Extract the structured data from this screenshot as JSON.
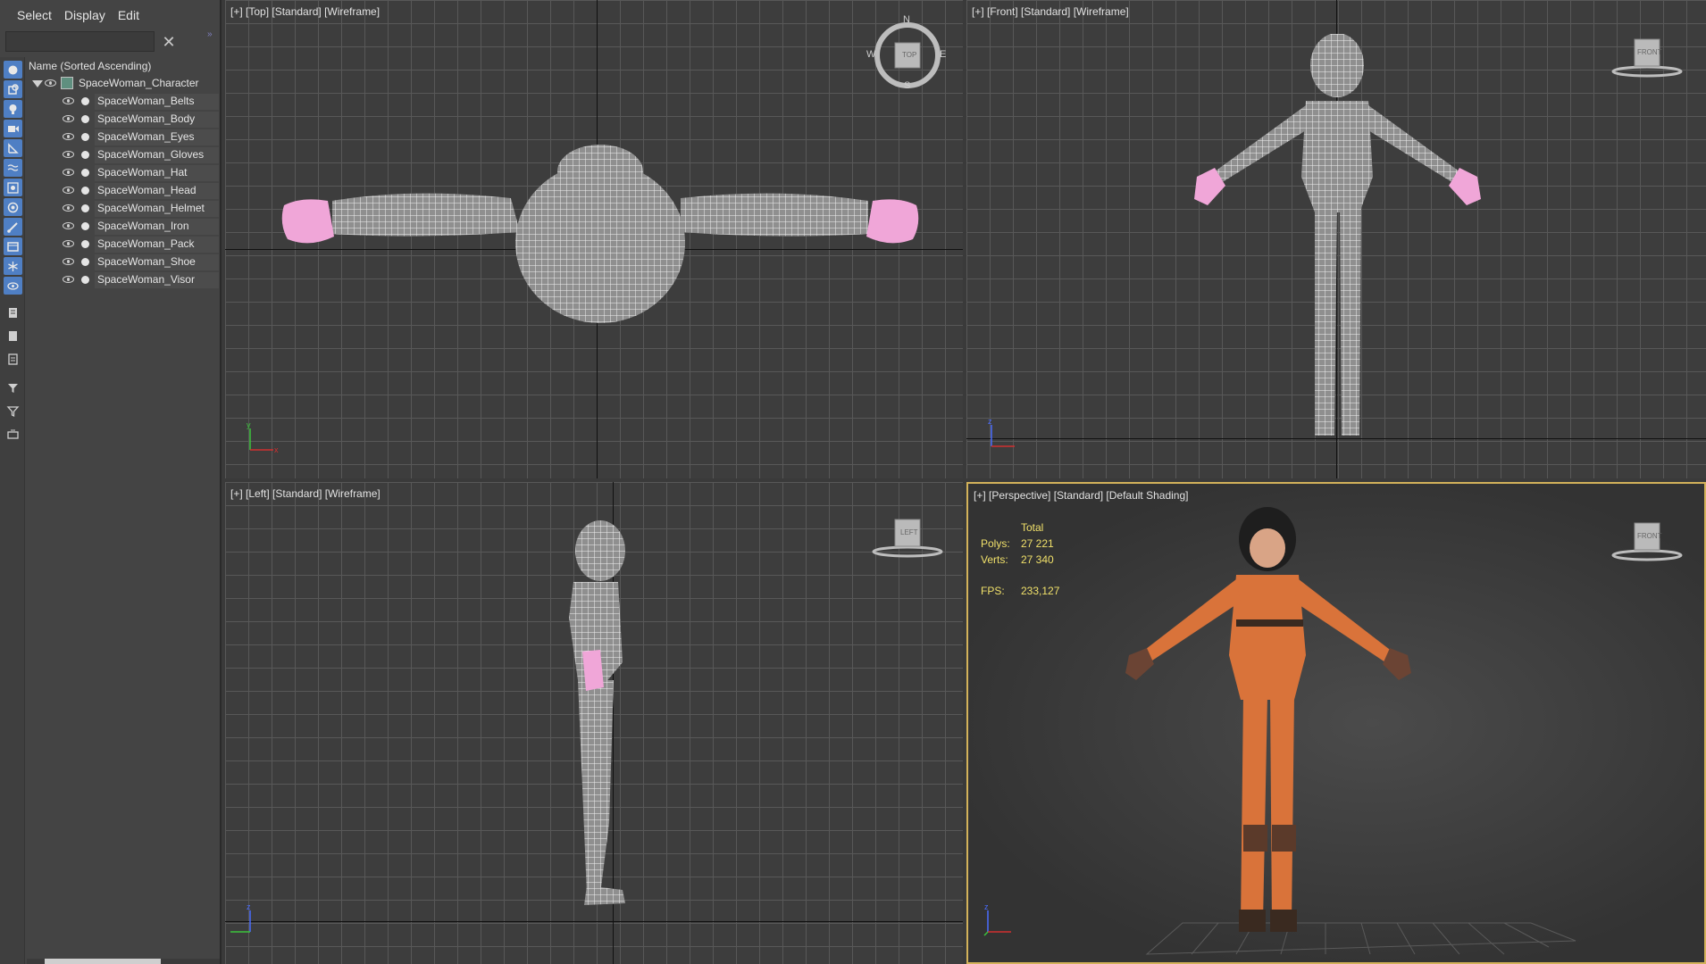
{
  "menu": {
    "select": "Select",
    "display": "Display",
    "edit": "Edit"
  },
  "search": {
    "value": "",
    "clear_icon": "close-icon"
  },
  "explorer": {
    "column_header": "Name (Sorted Ascending)",
    "root": "SpaceWoman_Character",
    "children": [
      "SpaceWoman_Belts",
      "SpaceWoman_Body",
      "SpaceWoman_Eyes",
      "SpaceWoman_Gloves",
      "SpaceWoman_Hat",
      "SpaceWoman_Head",
      "SpaceWoman_Helmet",
      "SpaceWoman_Iron",
      "SpaceWoman_Pack",
      "SpaceWoman_Shoe",
      "SpaceWoman_Visor"
    ]
  },
  "toolstrip": [
    "display-all-icon",
    "geometry-icon",
    "lights-icon",
    "cameras-icon",
    "helpers-icon",
    "spacewarps-icon",
    "groups-icon",
    "xrefs-icon",
    "bones-icon",
    "containers-icon",
    "frozen-icon",
    "hidden-icon",
    "layer-explorer-icon",
    "selection-sets-icon",
    "display-children-icon",
    "filter-icon",
    "filter-funnel-icon",
    "sort-icon"
  ],
  "viewports": {
    "top": {
      "label": "[+] [Top] [Standard] [Wireframe]",
      "cube": "TOP",
      "compass": {
        "n": "N",
        "s": "S",
        "e": "E",
        "w": "W"
      }
    },
    "front": {
      "label": "[+] [Front] [Standard] [Wireframe]",
      "cube": "FRONT"
    },
    "left": {
      "label": "[+] [Left] [Standard] [Wireframe]",
      "cube": "LEFT"
    },
    "perspective": {
      "label": "[+] [Perspective] [Standard] [Default Shading]",
      "cube": "FRONT",
      "stats": {
        "total_label": "Total",
        "polys_label": "Polys:",
        "polys_value": "27 221",
        "verts_label": "Verts:",
        "verts_value": "27 340",
        "fps_label": "FPS:",
        "fps_value": "233,127"
      }
    }
  },
  "colors": {
    "wire": "#e8e8e8",
    "gloves": "#f0a6d8",
    "suit": "#d9733a",
    "active_border": "#d3b25a",
    "stats_text": "#f0e06a"
  }
}
